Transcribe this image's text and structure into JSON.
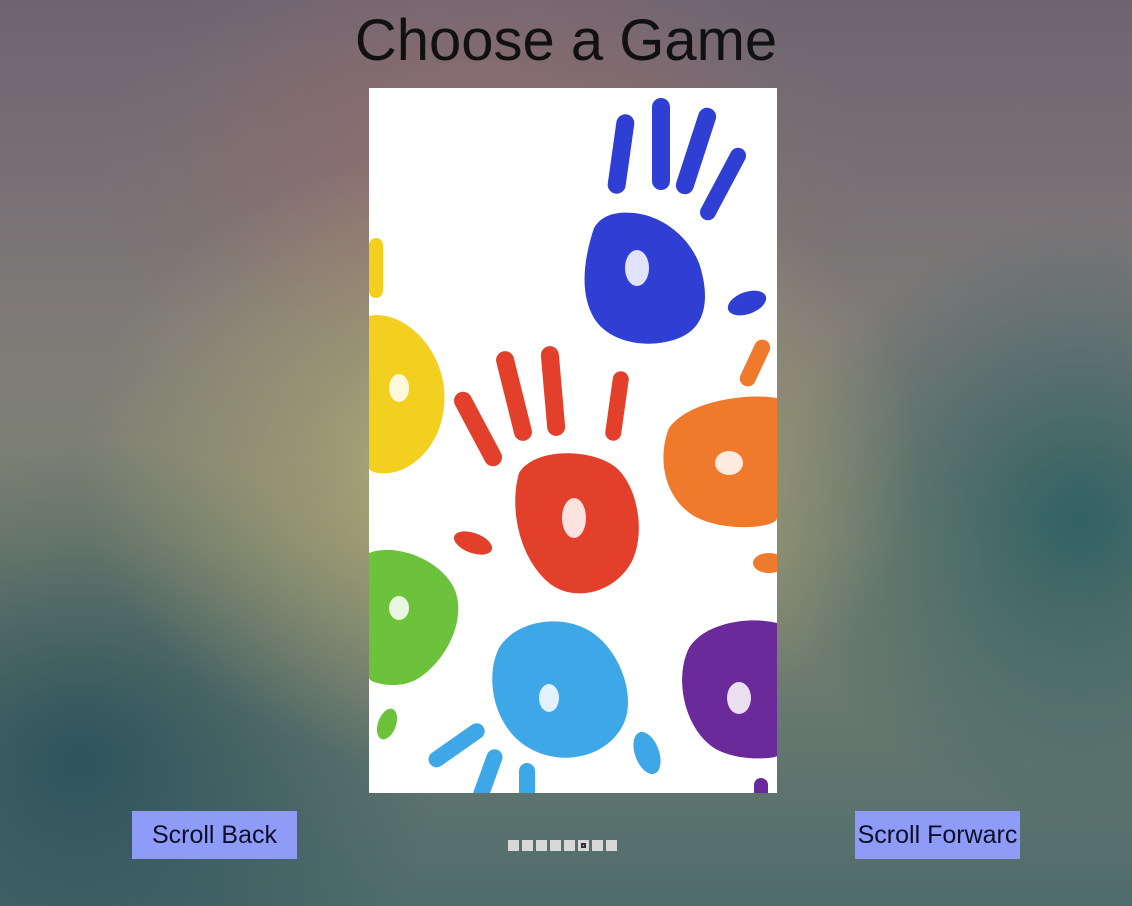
{
  "page": {
    "title": "Choose a Game"
  },
  "carousel": {
    "image_icon": "colorful-handprints-image",
    "page_count": 8,
    "active_index": 5
  },
  "controls": {
    "scroll_back_label": "Scroll Back",
    "scroll_forward_label": "Scroll Forwarc"
  },
  "colors": {
    "button_bg": "#8e9cf7",
    "card_bg": "#ffffff",
    "dot_color": "#d8d8d8",
    "hand_blue": "#2f3fd4",
    "hand_red": "#e2402a",
    "hand_orange": "#f07a2b",
    "hand_yellow": "#f3cf1f",
    "hand_green": "#6cc23a",
    "hand_lightblue": "#3ea7e8",
    "hand_purple": "#6a2a9a"
  }
}
